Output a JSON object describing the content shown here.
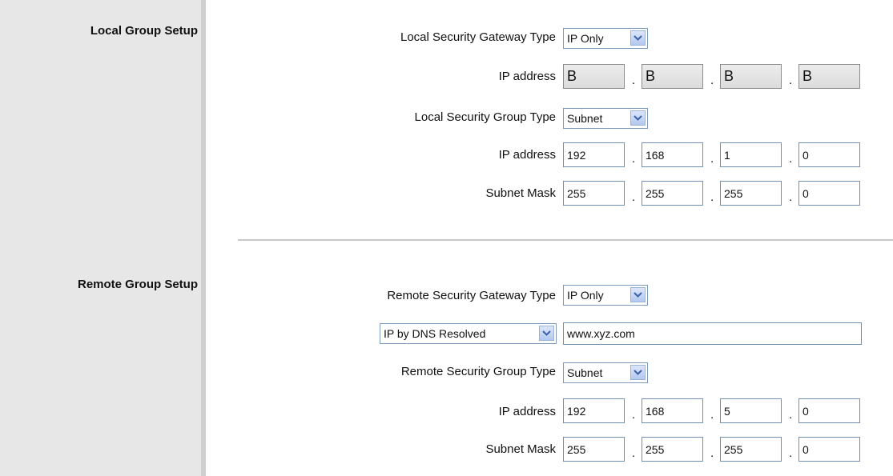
{
  "sections": {
    "local_title": "Local Group Setup",
    "remote_title": "Remote Group Setup"
  },
  "local": {
    "gateway_type_label": "Local Security Gateway Type",
    "gateway_type_value": "IP Only",
    "gateway_ip_label": "IP address",
    "gateway_ip": [
      "B",
      "B",
      "B",
      "B"
    ],
    "group_type_label": "Local Security Group Type",
    "group_type_value": "Subnet",
    "ip_label": "IP address",
    "ip": [
      "192",
      "168",
      "1",
      "0"
    ],
    "mask_label": "Subnet Mask",
    "mask": [
      "255",
      "255",
      "255",
      "0"
    ]
  },
  "remote": {
    "gateway_type_label": "Remote Security Gateway Type",
    "gateway_type_value": "IP Only",
    "dns_mode_value": "IP by DNS Resolved",
    "dns_value": "www.xyz.com",
    "group_type_label": "Remote Security Group Type",
    "group_type_value": "Subnet",
    "ip_label": "IP address",
    "ip": [
      "192",
      "168",
      "5",
      "0"
    ],
    "mask_label": "Subnet Mask",
    "mask": [
      "255",
      "255",
      "255",
      "0"
    ]
  },
  "separator": ".",
  "icons": {
    "dropdown": "chevron-down-icon"
  }
}
